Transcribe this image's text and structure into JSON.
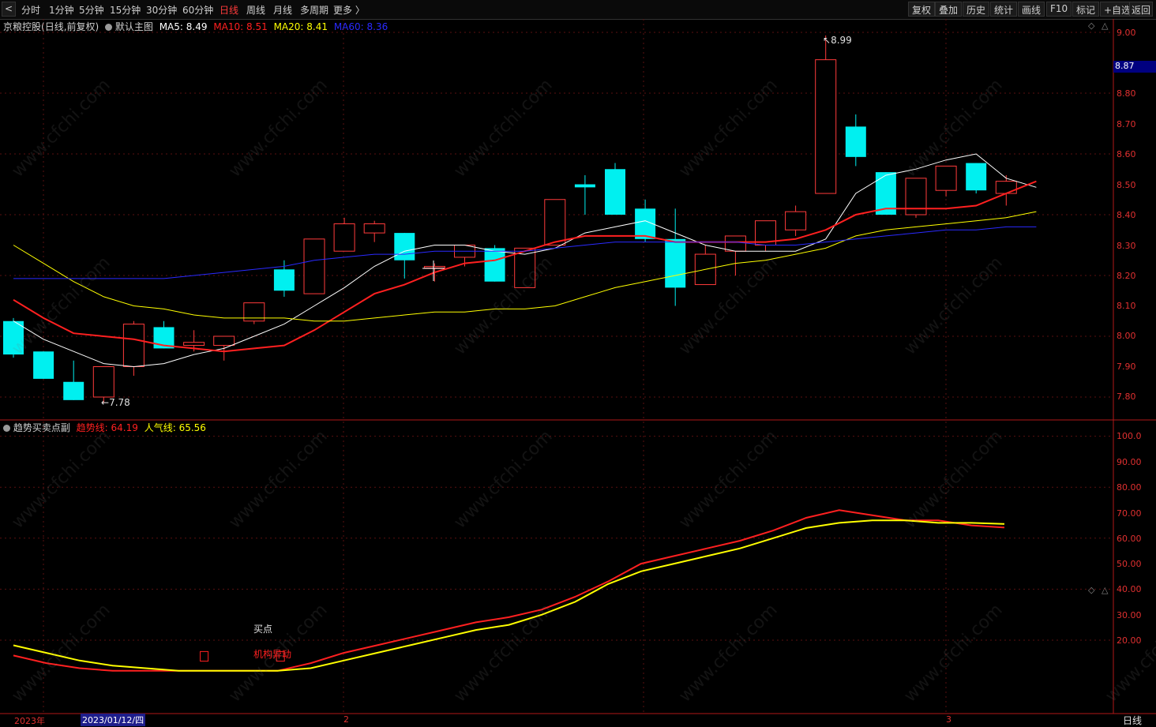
{
  "toolbar": {
    "back_arrow": "<",
    "periods": [
      "分时",
      "1分钟",
      "5分钟",
      "15分钟",
      "30分钟",
      "60分钟",
      "日线",
      "周线",
      "月线",
      "多周期",
      "更多 〉"
    ],
    "active_period": "日线",
    "right_buttons": [
      "复权",
      "叠加",
      "历史",
      "统计",
      "画线",
      "F10",
      "标记",
      "+自选",
      "返回"
    ]
  },
  "main_chart": {
    "stock": "京粮控股",
    "mode": "(日线,前复权)",
    "template": "默认主图",
    "ma": [
      {
        "label": "MA5: 8.49",
        "color": "#ffffff"
      },
      {
        "label": "MA10: 8.51",
        "color": "#ff2020"
      },
      {
        "label": "MA20: 8.41",
        "color": "#ffff00"
      },
      {
        "label": "MA60: 8.36",
        "color": "#2a2aff"
      }
    ],
    "high_label": "8.99",
    "low_label": "7.78",
    "current_price": "8.87",
    "y_ticks": [
      "9.00",
      "8.80",
      "8.70",
      "8.60",
      "8.50",
      "8.40",
      "8.30",
      "8.20",
      "8.10",
      "8.00",
      "7.90",
      "7.80"
    ]
  },
  "sub_chart": {
    "name": "趋势买卖点副",
    "line1": {
      "label": "趋势线: 64.19",
      "color": "#ff2020"
    },
    "line2": {
      "label": "人气线: 65.56",
      "color": "#ffff00"
    },
    "y_ticks": [
      "100.0",
      "90.00",
      "80.00",
      "70.00",
      "60.00",
      "50.00",
      "40.00",
      "30.00",
      "20.00"
    ],
    "annotations": {
      "buy": "买点",
      "inst": "机构异动"
    }
  },
  "x_axis": {
    "labels": [
      "2023年",
      "2",
      "3"
    ],
    "cursor_date": "2023/01/12/四",
    "period_label": "日线"
  },
  "watermark": "www.cfchi.com",
  "chart_data": {
    "type": "candlestick",
    "x": [
      "d1",
      "d2",
      "d3",
      "d4",
      "d5",
      "d6",
      "d7",
      "d8",
      "d9",
      "d10",
      "d11",
      "d12",
      "d13",
      "d14",
      "d15",
      "d16",
      "d17",
      "d18",
      "d19",
      "d20",
      "d21",
      "d22",
      "d23",
      "d24",
      "d25",
      "d26",
      "d27",
      "d28",
      "d29",
      "d30",
      "d31",
      "d32",
      "d33"
    ],
    "ohlc": [
      [
        8.05,
        8.06,
        7.93,
        7.94
      ],
      [
        7.95,
        7.95,
        7.86,
        7.86
      ],
      [
        7.85,
        7.92,
        7.79,
        7.79
      ],
      [
        7.8,
        7.9,
        7.78,
        7.9
      ],
      [
        7.9,
        8.05,
        7.87,
        8.04
      ],
      [
        8.03,
        8.05,
        7.96,
        7.96
      ],
      [
        7.97,
        8.02,
        7.95,
        7.98
      ],
      [
        7.97,
        8.0,
        7.92,
        8.0
      ],
      [
        8.05,
        8.11,
        8.04,
        8.11
      ],
      [
        8.22,
        8.25,
        8.13,
        8.15
      ],
      [
        8.14,
        8.32,
        8.14,
        8.32
      ],
      [
        8.28,
        8.39,
        8.28,
        8.37
      ],
      [
        8.34,
        8.38,
        8.31,
        8.37
      ],
      [
        8.34,
        8.34,
        8.19,
        8.25
      ],
      [
        8.23,
        8.24,
        8.18,
        8.23
      ],
      [
        8.26,
        8.28,
        8.23,
        8.3
      ],
      [
        8.29,
        8.3,
        8.18,
        8.18
      ],
      [
        8.16,
        8.29,
        8.16,
        8.29
      ],
      [
        8.3,
        8.45,
        8.3,
        8.45
      ],
      [
        8.5,
        8.53,
        8.4,
        8.49
      ],
      [
        8.55,
        8.57,
        8.4,
        8.4
      ],
      [
        8.42,
        8.45,
        8.31,
        8.32
      ],
      [
        8.32,
        8.42,
        8.1,
        8.16
      ],
      [
        8.17,
        8.3,
        8.17,
        8.27
      ],
      [
        8.28,
        8.33,
        8.2,
        8.33
      ],
      [
        8.3,
        8.38,
        8.28,
        8.38
      ],
      [
        8.35,
        8.43,
        8.33,
        8.41
      ],
      [
        8.47,
        8.99,
        8.47,
        8.91
      ],
      [
        8.69,
        8.73,
        8.56,
        8.59
      ],
      [
        8.54,
        8.54,
        8.4,
        8.4
      ],
      [
        8.4,
        8.52,
        8.39,
        8.52
      ],
      [
        8.48,
        8.56,
        8.46,
        8.56
      ],
      [
        8.57,
        8.57,
        8.47,
        8.48
      ]
    ],
    "extra_candle": [
      8.47,
      8.53,
      8.43,
      8.51
    ],
    "ma_series": [
      {
        "name": "MA5",
        "values": [
          8.05,
          7.99,
          7.95,
          7.91,
          7.9,
          7.91,
          7.94,
          7.96,
          8.0,
          8.04,
          8.1,
          8.16,
          8.23,
          8.28,
          8.3,
          8.3,
          8.28,
          8.27,
          8.29,
          8.34,
          8.36,
          8.38,
          8.34,
          8.3,
          8.28,
          8.28,
          8.28,
          8.32,
          8.47,
          8.53,
          8.55,
          8.58,
          8.6,
          8.52,
          8.49
        ]
      },
      {
        "name": "MA10",
        "values": [
          8.12,
          8.06,
          8.01,
          8.0,
          7.99,
          7.97,
          7.96,
          7.95,
          7.96,
          7.97,
          8.02,
          8.08,
          8.14,
          8.17,
          8.21,
          8.24,
          8.25,
          8.28,
          8.31,
          8.33,
          8.33,
          8.33,
          8.31,
          8.31,
          8.31,
          8.31,
          8.32,
          8.35,
          8.4,
          8.42,
          8.42,
          8.42,
          8.43,
          8.47,
          8.51
        ]
      },
      {
        "name": "MA20",
        "values": [
          8.3,
          8.24,
          8.18,
          8.13,
          8.1,
          8.09,
          8.07,
          8.06,
          8.06,
          8.06,
          8.05,
          8.05,
          8.06,
          8.07,
          8.08,
          8.08,
          8.09,
          8.09,
          8.1,
          8.13,
          8.16,
          8.18,
          8.2,
          8.22,
          8.24,
          8.25,
          8.27,
          8.29,
          8.33,
          8.35,
          8.36,
          8.37,
          8.38,
          8.39,
          8.41
        ]
      },
      {
        "name": "MA60",
        "values": [
          8.19,
          8.19,
          8.19,
          8.19,
          8.19,
          8.19,
          8.2,
          8.21,
          8.22,
          8.23,
          8.25,
          8.26,
          8.27,
          8.27,
          8.28,
          8.28,
          8.28,
          8.28,
          8.29,
          8.3,
          8.31,
          8.31,
          8.31,
          8.31,
          8.31,
          8.3,
          8.3,
          8.31,
          8.32,
          8.33,
          8.34,
          8.35,
          8.35,
          8.36,
          8.36
        ]
      }
    ],
    "sub_series": [
      {
        "name": "趋势线",
        "values": [
          14,
          11,
          9,
          8,
          8,
          8,
          8,
          8,
          8,
          11,
          15,
          18,
          21,
          24,
          27,
          29,
          32,
          37,
          43,
          50,
          53,
          56,
          59,
          63,
          68,
          71,
          69,
          67,
          67,
          65,
          64.19
        ]
      },
      {
        "name": "人气线",
        "values": [
          18,
          15,
          12,
          10,
          9,
          8,
          8,
          8,
          8,
          9,
          12,
          15,
          18,
          21,
          24,
          26,
          30,
          35,
          42,
          47,
          50,
          53,
          56,
          60,
          64,
          66,
          67,
          67,
          66,
          66,
          65.56
        ]
      }
    ],
    "sub_markers": [
      [
        7.5,
        0,
        14
      ],
      [
        10.5,
        0,
        14
      ]
    ],
    "ylim": [
      7.75,
      9.05
    ],
    "sub_ylim": [
      0,
      110
    ]
  }
}
